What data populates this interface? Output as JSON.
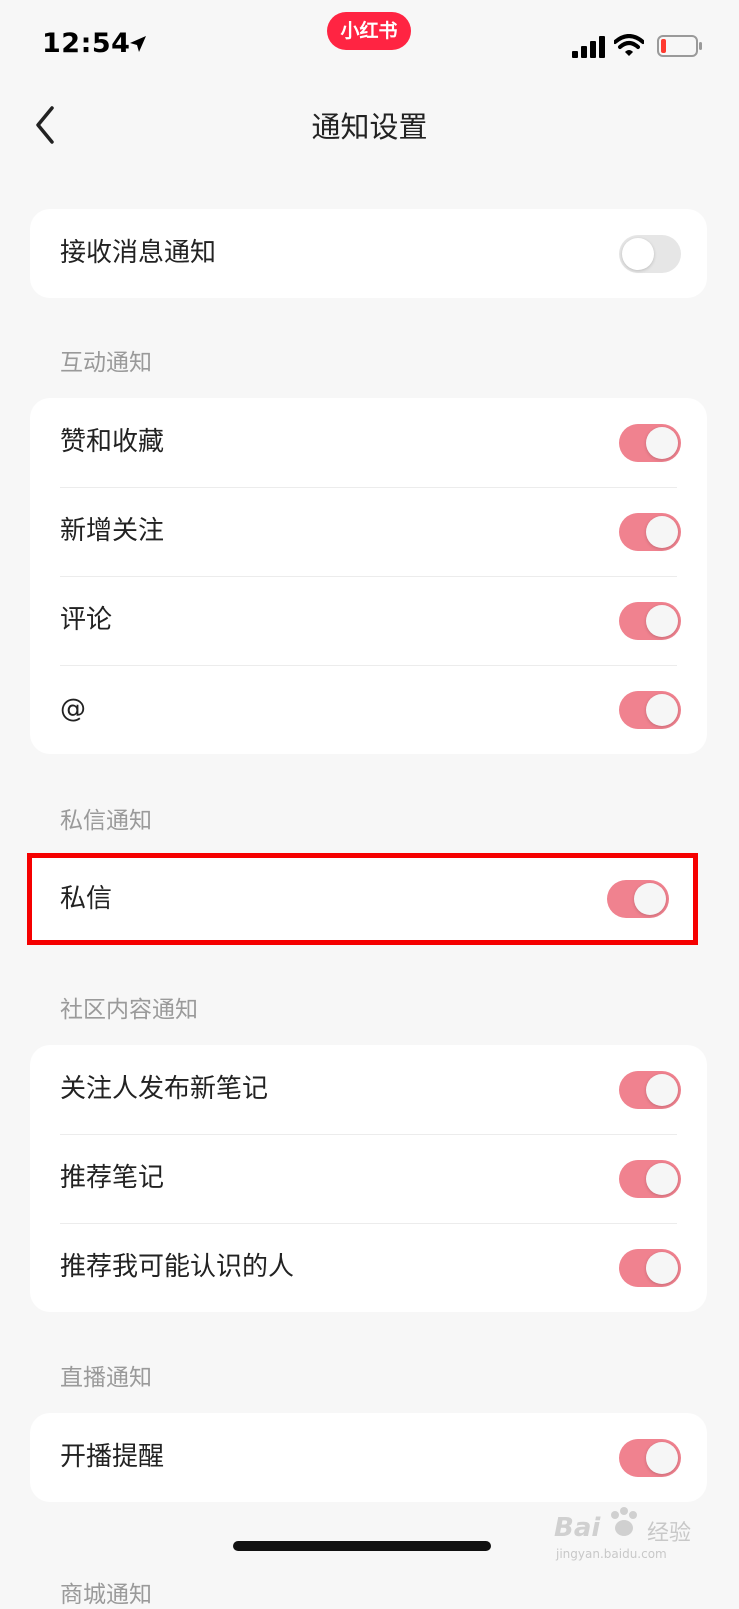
{
  "status_bar": {
    "time": "12:54",
    "brand": "小红书",
    "location_icon": "location-arrow-icon",
    "signal_icon": "cellular-signal-icon",
    "wifi_icon": "wifi-icon",
    "battery_icon": "battery-low-icon"
  },
  "nav": {
    "back_icon": "chevron-left-icon",
    "title": "通知设置"
  },
  "master": {
    "label": "接收消息通知",
    "on": false
  },
  "sections": [
    {
      "header": "互动通知",
      "items": [
        {
          "label": "赞和收藏",
          "on": true
        },
        {
          "label": "新增关注",
          "on": true
        },
        {
          "label": "评论",
          "on": true
        },
        {
          "label": "@",
          "on": true
        }
      ]
    },
    {
      "header": "私信通知",
      "items": [
        {
          "label": "私信",
          "on": true
        }
      ]
    },
    {
      "header": "社区内容通知",
      "items": [
        {
          "label": "关注人发布新笔记",
          "on": true
        },
        {
          "label": "推荐笔记",
          "on": true
        },
        {
          "label": "推荐我可能认识的人",
          "on": true
        }
      ]
    },
    {
      "header": "直播通知",
      "items": [
        {
          "label": "开播提醒",
          "on": true
        }
      ]
    },
    {
      "header": "商城通知",
      "items": []
    }
  ],
  "colors": {
    "toggle_on": "#f0828f",
    "toggle_off": "#e6e6e6",
    "brand": "#ff2442",
    "highlight": "#f50000"
  },
  "watermark": {
    "text": "Bai",
    "text2": "经验",
    "url": "jingyan.baidu.com"
  }
}
